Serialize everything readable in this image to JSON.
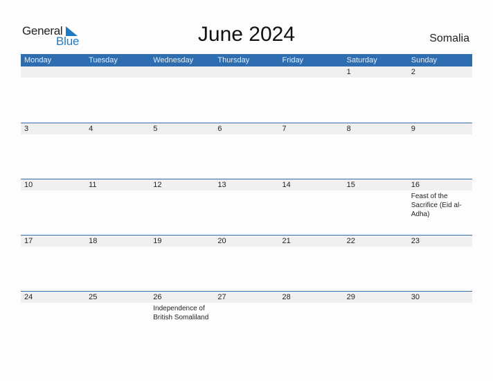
{
  "logo": {
    "general": "General",
    "blue": "Blue",
    "accent": "#1f7ac4"
  },
  "title": "June 2024",
  "country": "Somalia",
  "colors": {
    "header": "#2e6db0",
    "strip": "#f0f0f0"
  },
  "weekdays": [
    "Monday",
    "Tuesday",
    "Wednesday",
    "Thursday",
    "Friday",
    "Saturday",
    "Sunday"
  ],
  "weeks": [
    [
      {
        "day": "",
        "event": ""
      },
      {
        "day": "",
        "event": ""
      },
      {
        "day": "",
        "event": ""
      },
      {
        "day": "",
        "event": ""
      },
      {
        "day": "",
        "event": ""
      },
      {
        "day": "1",
        "event": ""
      },
      {
        "day": "2",
        "event": ""
      }
    ],
    [
      {
        "day": "3",
        "event": ""
      },
      {
        "day": "4",
        "event": ""
      },
      {
        "day": "5",
        "event": ""
      },
      {
        "day": "6",
        "event": ""
      },
      {
        "day": "7",
        "event": ""
      },
      {
        "day": "8",
        "event": ""
      },
      {
        "day": "9",
        "event": ""
      }
    ],
    [
      {
        "day": "10",
        "event": ""
      },
      {
        "day": "11",
        "event": ""
      },
      {
        "day": "12",
        "event": ""
      },
      {
        "day": "13",
        "event": ""
      },
      {
        "day": "14",
        "event": ""
      },
      {
        "day": "15",
        "event": ""
      },
      {
        "day": "16",
        "event": "Feast of the Sacrifice (Eid al-Adha)"
      }
    ],
    [
      {
        "day": "17",
        "event": ""
      },
      {
        "day": "18",
        "event": ""
      },
      {
        "day": "19",
        "event": ""
      },
      {
        "day": "20",
        "event": ""
      },
      {
        "day": "21",
        "event": ""
      },
      {
        "day": "22",
        "event": ""
      },
      {
        "day": "23",
        "event": ""
      }
    ],
    [
      {
        "day": "24",
        "event": ""
      },
      {
        "day": "25",
        "event": ""
      },
      {
        "day": "26",
        "event": "Independence of British Somaliland"
      },
      {
        "day": "27",
        "event": ""
      },
      {
        "day": "28",
        "event": ""
      },
      {
        "day": "29",
        "event": ""
      },
      {
        "day": "30",
        "event": ""
      }
    ]
  ]
}
